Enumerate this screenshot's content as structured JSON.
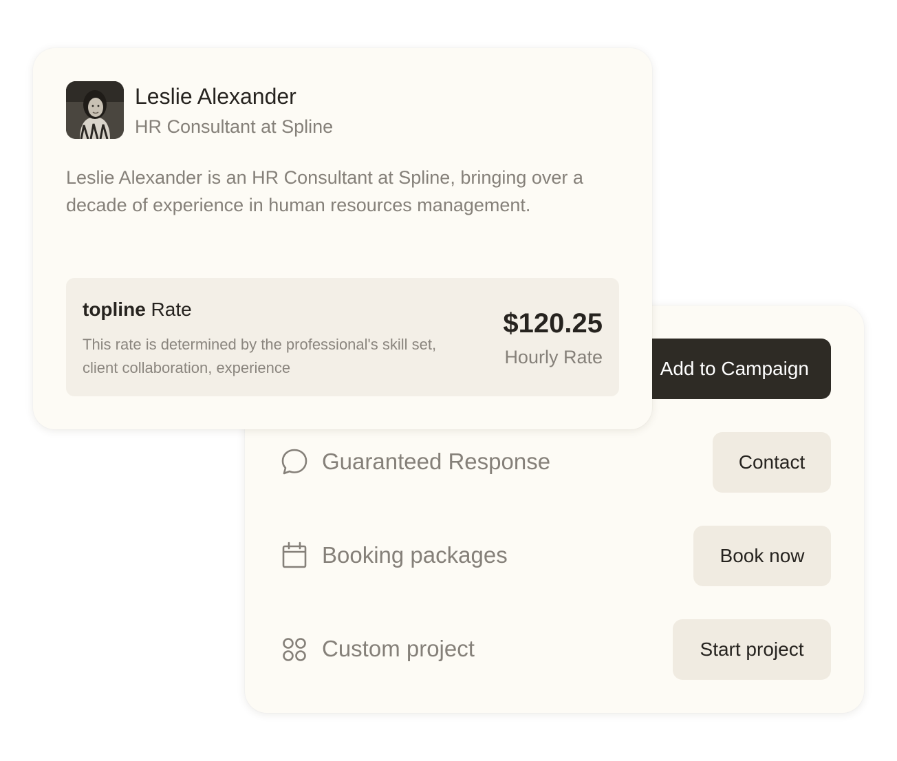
{
  "profile": {
    "name": "Leslie Alexander",
    "role": "HR Consultant at Spline",
    "bio": "Leslie Alexander is an HR Consultant at Spline, bringing over a decade of experience in human resources management.",
    "avatar_icon": "person-photo"
  },
  "rate": {
    "brand": "topline",
    "title": "Rate",
    "description": "This rate is determined by the professional's skill set, client collaboration, experience",
    "amount": "$120.25",
    "unit": "Hourly Rate"
  },
  "actions": {
    "primary_label": "Add to Campaign",
    "rows": [
      {
        "icon": "chat-bubble-icon",
        "label": "Guaranteed Response",
        "button": "Contact"
      },
      {
        "icon": "calendar-icon",
        "label": "Booking packages",
        "button": "Book now"
      },
      {
        "icon": "grid-circles-icon",
        "label": "Custom project",
        "button": "Start project"
      }
    ]
  },
  "colors": {
    "card_bg": "#fdfbf5",
    "rate_bg": "#f3efe7",
    "primary_button": "#2e2b25",
    "secondary_button": "#f0ebe1",
    "text_dark": "#26231f",
    "text_muted": "#858079"
  }
}
